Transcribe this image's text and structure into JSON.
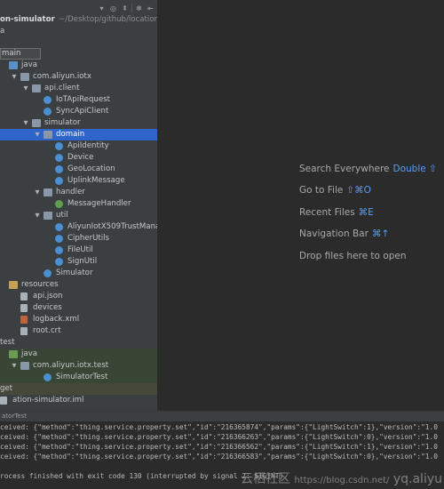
{
  "project": {
    "header_title": "on-simulator",
    "header_path": "~/Desktop/github/location-",
    "row_a": "a",
    "main_label": "main",
    "tree": [
      {
        "label": "java",
        "indent": 0,
        "arrow": "",
        "icon": "folder blue"
      },
      {
        "label": "com.aliyun.iotx",
        "indent": 1,
        "arrow": "▼",
        "icon": "pkg"
      },
      {
        "label": "api.client",
        "indent": 2,
        "arrow": "▼",
        "icon": "pkg"
      },
      {
        "label": "IoTApiRequest",
        "indent": 3,
        "arrow": "",
        "icon": "cls"
      },
      {
        "label": "SyncApiClient",
        "indent": 3,
        "arrow": "",
        "icon": "cls"
      },
      {
        "label": "simulator",
        "indent": 2,
        "arrow": "▼",
        "icon": "pkg"
      },
      {
        "label": "domain",
        "indent": 3,
        "arrow": "▼",
        "icon": "pkg",
        "selected": true
      },
      {
        "label": "ApiIdentity",
        "indent": 4,
        "arrow": "",
        "icon": "cls"
      },
      {
        "label": "Device",
        "indent": 4,
        "arrow": "",
        "icon": "cls"
      },
      {
        "label": "GeoLocation",
        "indent": 4,
        "arrow": "",
        "icon": "cls"
      },
      {
        "label": "UplinkMessage",
        "indent": 4,
        "arrow": "",
        "icon": "cls"
      },
      {
        "label": "handler",
        "indent": 3,
        "arrow": "▼",
        "icon": "pkg"
      },
      {
        "label": "MessageHandler",
        "indent": 4,
        "arrow": "",
        "icon": "cls green"
      },
      {
        "label": "util",
        "indent": 3,
        "arrow": "▼",
        "icon": "pkg"
      },
      {
        "label": "AliyunIotX509TrustManag",
        "indent": 4,
        "arrow": "",
        "icon": "cls"
      },
      {
        "label": "CipherUtils",
        "indent": 4,
        "arrow": "",
        "icon": "cls"
      },
      {
        "label": "FileUtil",
        "indent": 4,
        "arrow": "",
        "icon": "cls"
      },
      {
        "label": "SignUtil",
        "indent": 4,
        "arrow": "",
        "icon": "cls"
      },
      {
        "label": "Simulator",
        "indent": 3,
        "arrow": "",
        "icon": "cls"
      },
      {
        "label": "resources",
        "indent": 0,
        "arrow": "",
        "icon": "folder yellow"
      },
      {
        "label": "api.json",
        "indent": 1,
        "arrow": "",
        "icon": "file"
      },
      {
        "label": "devices",
        "indent": 1,
        "arrow": "",
        "icon": "file"
      },
      {
        "label": "logback.xml",
        "indent": 1,
        "arrow": "",
        "icon": "xml"
      },
      {
        "label": "root.crt",
        "indent": 1,
        "arrow": "",
        "icon": "file"
      },
      {
        "label": "test",
        "indent": -1,
        "arrow": "",
        "icon": ""
      },
      {
        "label": "java",
        "indent": 0,
        "arrow": "",
        "icon": "folder green",
        "green": true
      },
      {
        "label": "com.aliyun.iotx.test",
        "indent": 1,
        "arrow": "▼",
        "icon": "pkg",
        "green": true
      },
      {
        "label": "SimulatorTest",
        "indent": 3,
        "arrow": "",
        "icon": "cls",
        "green": true
      },
      {
        "label": "get",
        "indent": -1,
        "arrow": "",
        "icon": "",
        "olive": true
      },
      {
        "label": "ation-simulator.iml",
        "indent": -1,
        "arrow": "",
        "icon": "file"
      }
    ]
  },
  "welcome": {
    "items": [
      {
        "label": "Search Everywhere",
        "shortcut": "Double ⇧"
      },
      {
        "label": "Go to File",
        "shortcut": "⇧⌘O"
      },
      {
        "label": "Recent Files",
        "shortcut": "⌘E"
      },
      {
        "label": "Navigation Bar",
        "shortcut": "⌘↑"
      },
      {
        "label": "Drop files here to open",
        "shortcut": ""
      }
    ]
  },
  "run": {
    "tab_label": "atorTest",
    "lines": [
      "ceived: {\"method\":\"thing.service.property.set\",\"id\":\"216365874\",\"params\":{\"LightSwitch\":1},\"version\":\"1.0",
      "ceived: {\"method\":\"thing.service.property.set\",\"id\":\"216366263\",\"params\":{\"LightSwitch\":0},\"version\":\"1.0",
      "ceived: {\"method\":\"thing.service.property.set\",\"id\":\"216366562\",\"params\":{\"LightSwitch\":1},\"version\":\"1.0",
      "ceived: {\"method\":\"thing.service.property.set\",\"id\":\"216366583\",\"params\":{\"LightSwitch\":0},\"version\":\"1.0",
      "",
      "rocess finished with exit code 130 (interrupted by signal 2: SIGINT)"
    ],
    "watermark_cn": "云栖社区",
    "watermark_url": "https://blog.csdn.net/",
    "watermark_tail": "yq.aliyu"
  }
}
